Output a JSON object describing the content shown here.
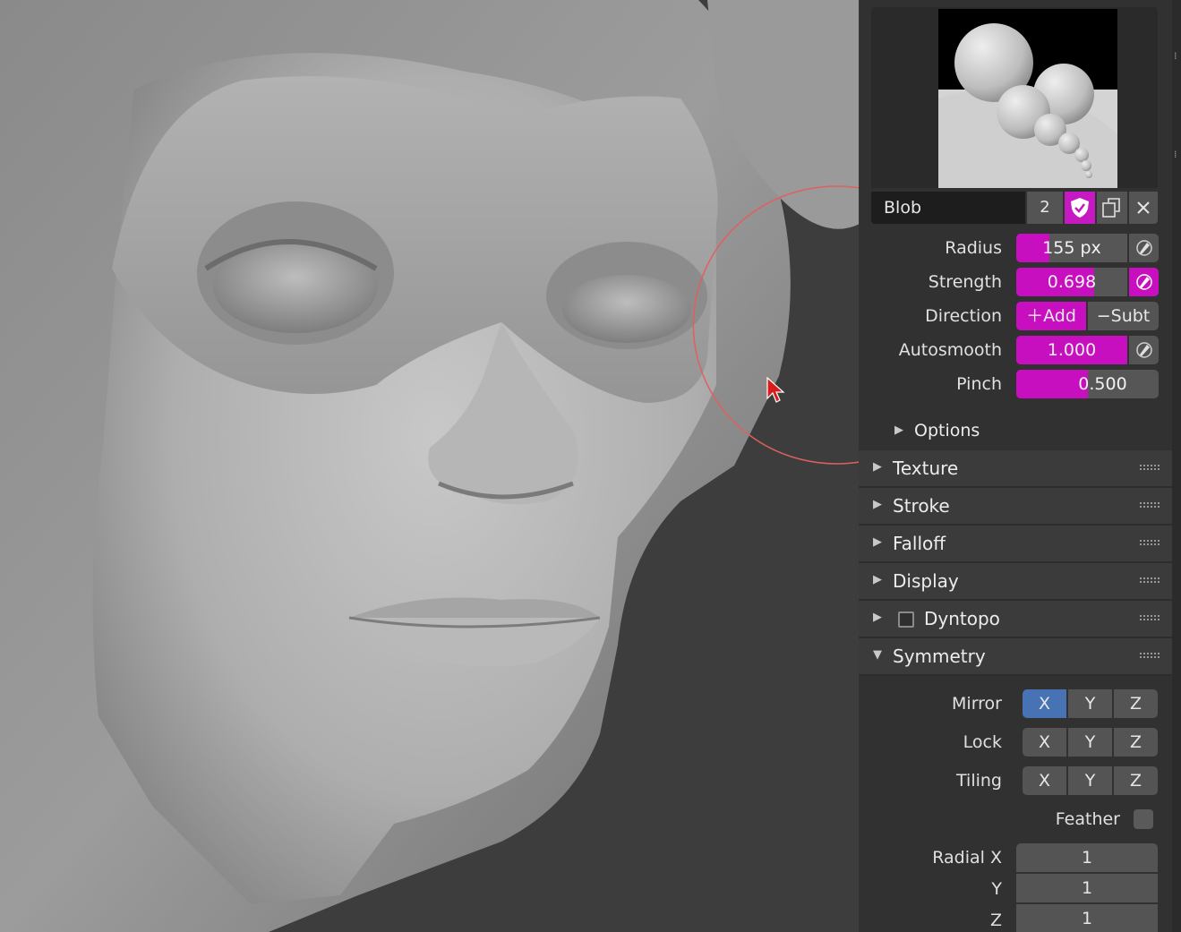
{
  "brush": {
    "name": "Blob",
    "users": "2",
    "colors": {
      "accent": "#c80fc0",
      "axis_active": "#4772b3",
      "panel": "#303030"
    }
  },
  "props": {
    "radius": {
      "label": "Radius",
      "value": "155 px",
      "fill": 0.3
    },
    "strength": {
      "label": "Strength",
      "value": "0.698",
      "fill": 0.698
    },
    "direction": {
      "label": "Direction",
      "add": "Add",
      "subtract": "Subt",
      "active": "add"
    },
    "autosmooth": {
      "label": "Autosmooth",
      "value": "1.000",
      "fill": 1.0
    },
    "pinch": {
      "label": "Pinch",
      "value": "0.500",
      "fill": 0.5
    }
  },
  "options": {
    "label": "Options"
  },
  "sections": [
    {
      "label": "Texture",
      "open": false
    },
    {
      "label": "Stroke",
      "open": false
    },
    {
      "label": "Falloff",
      "open": false
    },
    {
      "label": "Display",
      "open": false
    },
    {
      "label": "Dyntopo",
      "open": false,
      "checkbox": false
    },
    {
      "label": "Symmetry",
      "open": true
    }
  ],
  "symmetry": {
    "mirror": {
      "label": "Mirror",
      "x": "X",
      "y": "Y",
      "z": "Z",
      "active": [
        "X"
      ]
    },
    "lock": {
      "label": "Lock",
      "x": "X",
      "y": "Y",
      "z": "Z",
      "active": []
    },
    "tiling": {
      "label": "Tiling",
      "x": "X",
      "y": "Y",
      "z": "Z",
      "active": []
    },
    "feather": {
      "label": "Feather",
      "checked": false
    },
    "radial": {
      "label_x": "Radial X",
      "label_y": "Y",
      "label_z": "Z",
      "x": "1",
      "y": "1",
      "z": "1"
    }
  }
}
